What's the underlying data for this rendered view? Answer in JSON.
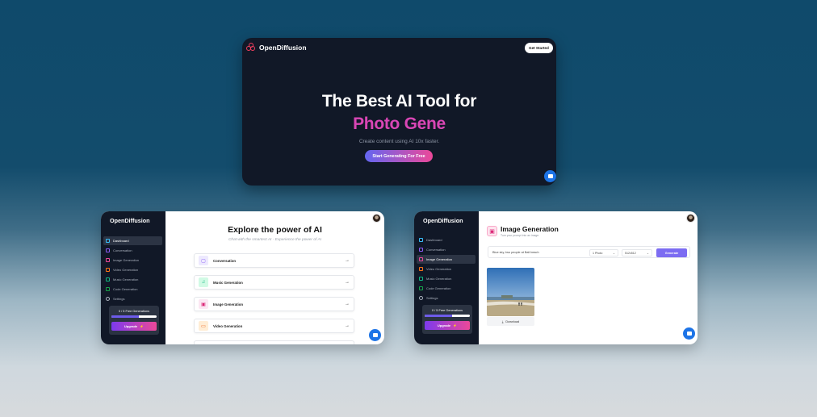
{
  "hero": {
    "brand": "OpenDiffusion",
    "cta_top": "Get Started",
    "headline": "The Best AI Tool for",
    "headline_accent": "Photo Gene",
    "subtitle": "Create content using AI 10x faster.",
    "cta": "Start Generating For Free"
  },
  "sidebar": {
    "brand": "OpenDiffusion",
    "items": [
      {
        "label": "Dashboard",
        "icon": "grid-icon",
        "color": "#38bdf8"
      },
      {
        "label": "Conversation",
        "icon": "message-icon",
        "color": "#8b5cf6"
      },
      {
        "label": "Image Generation",
        "icon": "image-icon",
        "color": "#ec4899"
      },
      {
        "label": "Video Generation",
        "icon": "video-icon",
        "color": "#f97316"
      },
      {
        "label": "Music Generation",
        "icon": "music-icon",
        "color": "#10b981"
      },
      {
        "label": "Code Generation",
        "icon": "code-icon",
        "color": "#16a34a"
      },
      {
        "label": "Settings",
        "icon": "gear-icon",
        "color": "#aab1bd"
      }
    ],
    "quota_text": "0 / 5 Free Generations",
    "quota_fraction": 0.6,
    "upgrade_label": "Upgrade"
  },
  "dashboard": {
    "title": "Explore the power of AI",
    "subtitle": "Chat with the smartest AI - Experience the power of AI",
    "tools": [
      {
        "label": "Conversation",
        "icon": "message-icon",
        "color": "#8b5cf6",
        "bg": "#ede9fe"
      },
      {
        "label": "Music Generation",
        "icon": "music-icon",
        "color": "#10b981",
        "bg": "#d1fae5"
      },
      {
        "label": "Image Generation",
        "icon": "image-icon",
        "color": "#db2777",
        "bg": "#fce7f3"
      },
      {
        "label": "Video Generation",
        "icon": "video-icon",
        "color": "#ea580c",
        "bg": "#ffedd5"
      }
    ]
  },
  "image_gen": {
    "title": "Image Generation",
    "subtitle": "Turn your prompt into an image.",
    "prompt": "Blue sky, two people at Bali beach",
    "amount": "1 Photo",
    "resolution": "512x512",
    "generate_label": "Generate",
    "download_label": "Download"
  }
}
